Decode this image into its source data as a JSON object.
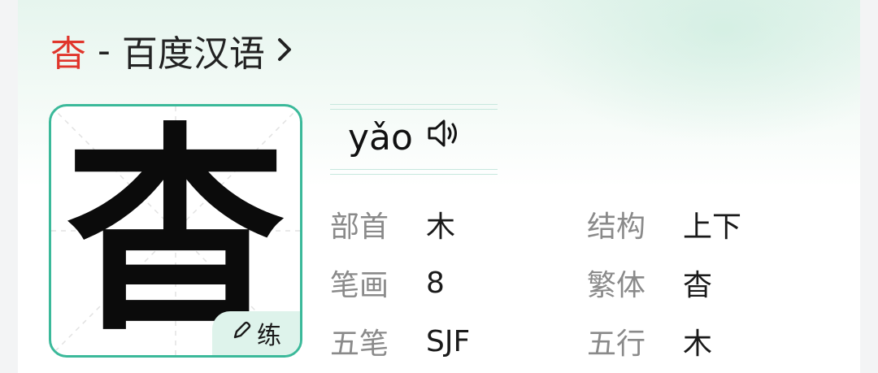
{
  "header": {
    "char": "杳",
    "separator": "-",
    "source": "百度汉语"
  },
  "character": {
    "glyph": "杳",
    "practice_label": "练"
  },
  "pinyin": "yǎo",
  "info": {
    "radical": {
      "label": "部首",
      "value": "木"
    },
    "structure": {
      "label": "结构",
      "value": "上下"
    },
    "strokes": {
      "label": "笔画",
      "value": "8"
    },
    "traditional": {
      "label": "繁体",
      "value": "杳"
    },
    "wubi": {
      "label": "五笔",
      "value": "SJF"
    },
    "wuxing": {
      "label": "五行",
      "value": "木"
    }
  },
  "colors": {
    "accent_red": "#e0352b",
    "accent_green": "#3bb99a"
  },
  "icons": [
    "chevron-right-icon",
    "speaker-icon",
    "pencil-icon"
  ]
}
